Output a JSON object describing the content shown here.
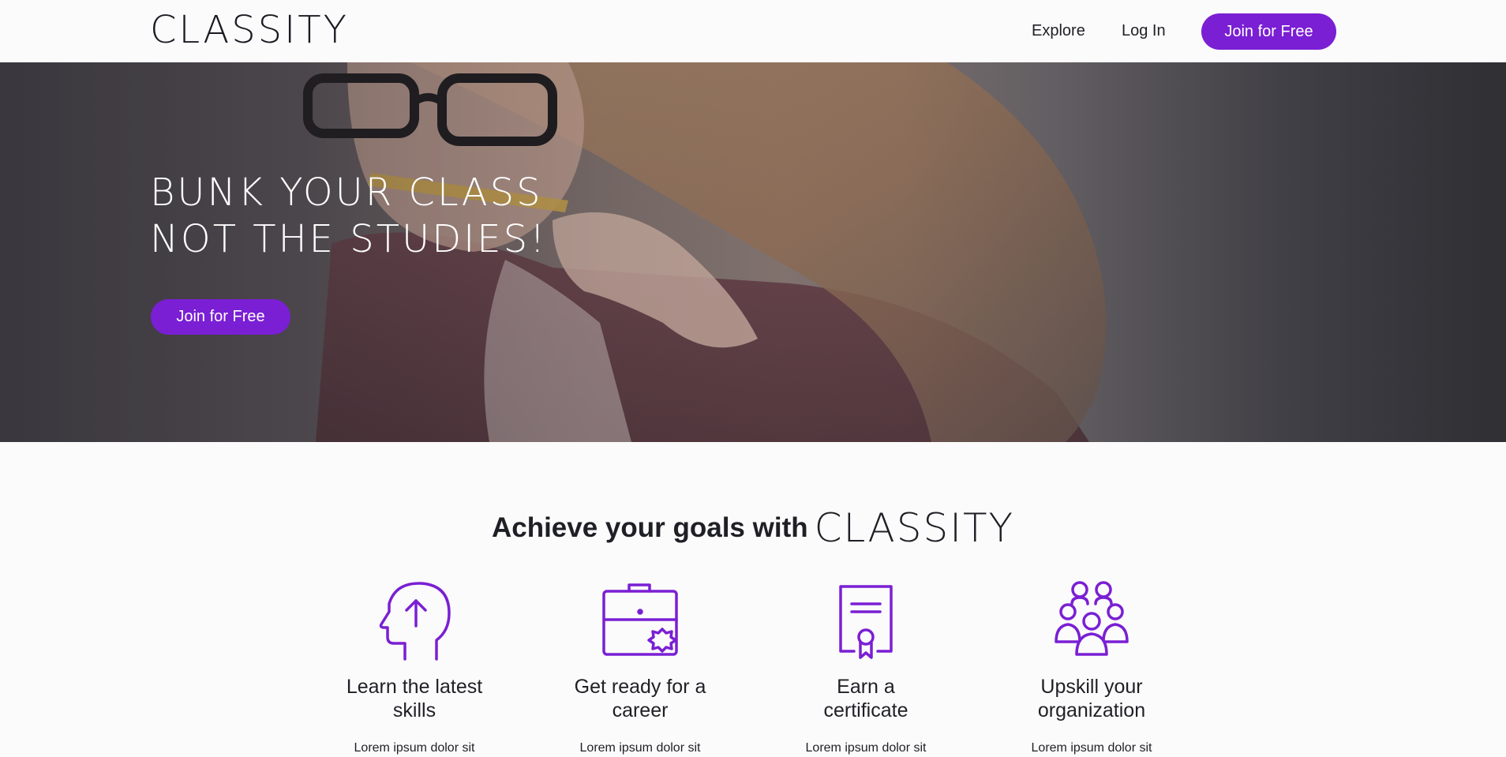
{
  "brand": {
    "logo": "CLASSITY",
    "accent": "#7a1fd4"
  },
  "nav": {
    "explore": "Explore",
    "login": "Log In",
    "join": "Join for Free"
  },
  "hero": {
    "title_line1": "BUNK YOUR CLASS",
    "title_line2": "NOT THE STUDIES!",
    "cta": "Join for Free",
    "image": "student-with-pencil-photo"
  },
  "goals": {
    "title": "Achieve your goals with",
    "brand": "CLASSITY",
    "features": [
      {
        "icon": "head-arrow-up-icon",
        "title_line1": "Learn the latest",
        "title_line2": "skills",
        "desc": "Lorem ipsum dolor sit"
      },
      {
        "icon": "briefcase-badge-icon",
        "title_line1": "Get ready for a",
        "title_line2": "career",
        "desc": "Lorem ipsum dolor sit"
      },
      {
        "icon": "certificate-icon",
        "title_line1": "Earn a",
        "title_line2": "certificate",
        "desc": "Lorem ipsum dolor sit"
      },
      {
        "icon": "group-people-icon",
        "title_line1": "Upskill your",
        "title_line2": "organization",
        "desc": "Lorem ipsum dolor sit"
      }
    ]
  }
}
